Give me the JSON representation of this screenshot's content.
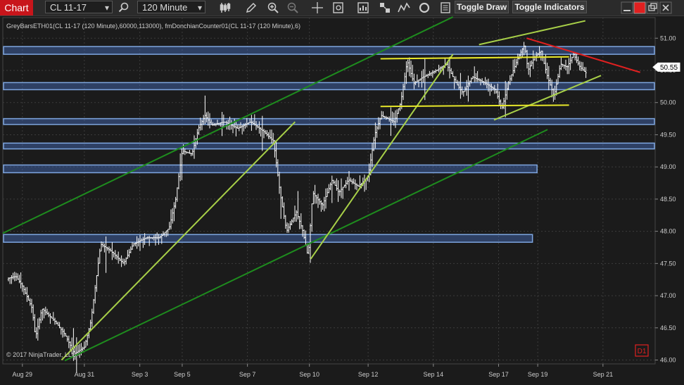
{
  "toolbar": {
    "chart_tab": "Chart",
    "instrument": "CL 11-17",
    "interval": "120 Minute",
    "toggle_draw": "Toggle Draw",
    "toggle_indicators": "Toggle Indicators",
    "colors": {
      "chart_tab": "#c8151b",
      "maximize": "#e02020"
    }
  },
  "chart_title": "GreyBarsETH01(CL 11-17 (120 Minute),60000,113000), fmDonchianCounter01(CL 11-17 (120 Minute),6)",
  "copyright": "© 2017 NinjaTrader, LLC",
  "indicator_badge": "D1",
  "chart_data": {
    "type": "bar",
    "instrument": "CL 11-17",
    "interval": "120 Minute",
    "x_ticks": [
      "Aug 29",
      "Aug 31",
      "Sep 3",
      "Sep 5",
      "Sep 7",
      "Sep 10",
      "Sep 12",
      "Sep 14",
      "Sep 17",
      "Sep 19",
      "Sep 21"
    ],
    "x_range": [
      0,
      100
    ],
    "x_tick_positions": [
      3,
      12.5,
      21,
      27.5,
      37.5,
      47,
      56,
      66,
      76,
      82,
      92
    ],
    "ylim": [
      45.94,
      51.32
    ],
    "y_ticks": [
      "51.00",
      "50.50",
      "50.00",
      "49.50",
      "49.00",
      "48.50",
      "48.00",
      "47.50",
      "47.00",
      "46.50",
      "46.00"
    ],
    "last_price": "50.55",
    "grid": true,
    "colors": {
      "bars": "#ffffff",
      "zones": "#7ea6e0",
      "channel_dark": "#1e8c1e",
      "trend_light": "#a8d048",
      "levels_yellow": "#e8e82a",
      "resistance_red": "#e02020"
    },
    "price_path": [
      [
        0,
        47.25
      ],
      [
        2,
        47.3
      ],
      [
        3,
        47.15
      ],
      [
        4.5,
        46.8
      ],
      [
        5,
        46.35
      ],
      [
        6,
        46.8
      ],
      [
        8,
        46.6
      ],
      [
        9.5,
        46.4
      ],
      [
        11,
        46.1
      ],
      [
        12.5,
        46.2
      ],
      [
        13.5,
        46.6
      ],
      [
        15,
        47.8
      ],
      [
        16.5,
        47.7
      ],
      [
        18.5,
        47.5
      ],
      [
        20,
        47.8
      ],
      [
        22,
        47.9
      ],
      [
        24,
        47.9
      ],
      [
        25.5,
        48.05
      ],
      [
        26.5,
        48.5
      ],
      [
        27.5,
        49.25
      ],
      [
        29,
        49.2
      ],
      [
        30,
        49.6
      ],
      [
        31,
        49.8
      ],
      [
        32,
        49.65
      ],
      [
        34,
        49.7
      ],
      [
        36,
        49.6
      ],
      [
        38,
        49.7
      ],
      [
        40,
        49.55
      ],
      [
        41.5,
        49.4
      ],
      [
        42.5,
        48.6
      ],
      [
        43.5,
        48.0
      ],
      [
        45,
        48.3
      ],
      [
        46,
        48.0
      ],
      [
        46.8,
        47.6
      ],
      [
        47.5,
        48.6
      ],
      [
        49,
        48.4
      ],
      [
        50.5,
        48.8
      ],
      [
        51.5,
        48.6
      ],
      [
        53,
        48.8
      ],
      [
        54.5,
        48.7
      ],
      [
        56,
        48.85
      ],
      [
        57,
        49.5
      ],
      [
        58,
        49.8
      ],
      [
        60,
        49.7
      ],
      [
        61,
        50.0
      ],
      [
        62,
        50.65
      ],
      [
        63,
        50.3
      ],
      [
        64.5,
        50.4
      ],
      [
        66.5,
        50.5
      ],
      [
        68,
        50.6
      ],
      [
        69.5,
        50.3
      ],
      [
        70.5,
        50.15
      ],
      [
        72,
        50.4
      ],
      [
        74,
        50.3
      ],
      [
        75.5,
        50.2
      ],
      [
        76.5,
        49.9
      ],
      [
        77.5,
        50.3
      ],
      [
        79,
        50.7
      ],
      [
        80,
        50.9
      ],
      [
        80.5,
        50.5
      ],
      [
        81.5,
        50.7
      ],
      [
        82.5,
        50.8
      ],
      [
        83.5,
        50.4
      ],
      [
        84.5,
        50.1
      ],
      [
        85.5,
        50.6
      ],
      [
        86.5,
        50.55
      ],
      [
        87.5,
        50.75
      ],
      [
        88.5,
        50.55
      ],
      [
        89.5,
        50.45
      ]
    ],
    "zones": [
      {
        "x1": 0,
        "x2": 100,
        "y_low": 50.75,
        "y_high": 50.87
      },
      {
        "x1": 0,
        "x2": 100,
        "y_low": 50.2,
        "y_high": 50.31
      },
      {
        "x1": 0,
        "x2": 100,
        "y_low": 49.66,
        "y_high": 49.75
      },
      {
        "x1": 0,
        "x2": 100,
        "y_low": 49.28,
        "y_high": 49.37
      },
      {
        "x1": 0,
        "x2": 82,
        "y_low": 48.91,
        "y_high": 49.03
      },
      {
        "x1": 0,
        "x2": 81.3,
        "y_low": 47.83,
        "y_high": 47.95
      }
    ],
    "trendlines": [
      {
        "color": "channel_dark",
        "points": [
          [
            0,
            47.97
          ],
          [
            69,
            51.33
          ]
        ]
      },
      {
        "color": "channel_dark",
        "points": [
          [
            9.5,
            45.99
          ],
          [
            83.5,
            49.58
          ]
        ]
      },
      {
        "color": "trend_light",
        "points": [
          [
            9,
            46.0
          ],
          [
            44.8,
            49.7
          ]
        ]
      },
      {
        "color": "trend_light",
        "points": [
          [
            47.2,
            47.57
          ],
          [
            69,
            50.75
          ]
        ]
      },
      {
        "color": "trend_light",
        "points": [
          [
            73,
            50.9
          ],
          [
            89.3,
            51.27
          ]
        ]
      },
      {
        "color": "trend_light",
        "points": [
          [
            75.3,
            49.73
          ],
          [
            91.7,
            50.42
          ]
        ]
      },
      {
        "color": "levels_yellow",
        "points": [
          [
            57.9,
            50.68
          ],
          [
            86.8,
            50.71
          ]
        ]
      },
      {
        "color": "levels_yellow",
        "points": [
          [
            57.9,
            49.94
          ],
          [
            86.8,
            49.96
          ]
        ]
      },
      {
        "color": "resistance_red",
        "points": [
          [
            80.3,
            51.0
          ],
          [
            97.7,
            50.47
          ]
        ]
      }
    ]
  }
}
